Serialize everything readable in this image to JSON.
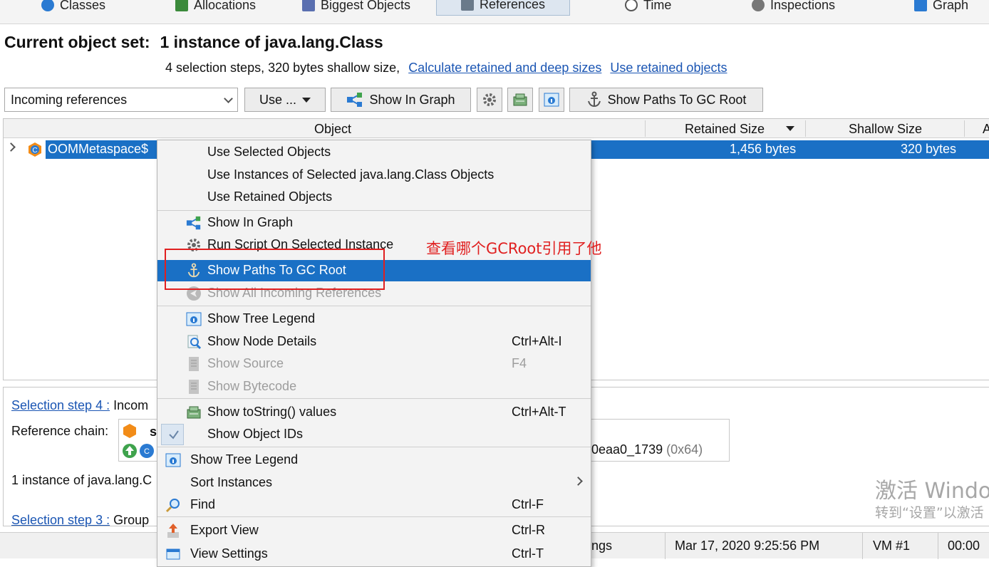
{
  "tabs": [
    {
      "label": "Classes",
      "icon": "classes-icon"
    },
    {
      "label": "Allocations",
      "icon": "allocations-icon"
    },
    {
      "label": "Biggest Objects",
      "icon": "biggest-objects-icon"
    },
    {
      "label": "References",
      "icon": "references-icon",
      "active": true
    },
    {
      "label": "Time",
      "icon": "clock-icon"
    },
    {
      "label": "Inspections",
      "icon": "gear-icon"
    },
    {
      "label": "Graph",
      "icon": "graph-icon"
    }
  ],
  "header": {
    "title_label": "Current object set:",
    "title_value": "1 instance of java.lang.Class",
    "info": "4 selection steps, 320 bytes shallow size,",
    "link_calc": "Calculate retained and deep sizes",
    "link_retained": "Use retained objects"
  },
  "toolbar": {
    "view_select": "Incoming references",
    "use_button": "Use ...",
    "show_in_graph": "Show In Graph",
    "show_paths": "Show Paths To GC Root"
  },
  "table": {
    "columns": [
      "Object",
      "Retained Size",
      "Shallow Size",
      "A"
    ],
    "rows": [
      {
        "object": "OOMMetaspace$",
        "retained": "1,456 bytes",
        "shallow": "320 bytes"
      }
    ]
  },
  "bottom": {
    "step4_link": "Selection step 4 :",
    "step4_text": "Incom",
    "chain_label": "Reference chain:",
    "chain_snippet": "s",
    "chain_id": "0eaa0_1739",
    "chain_hex": "(0x64)",
    "instance_text": "1 instance of java.lang.C",
    "step3_link": "Selection step 3 :",
    "step3_text": "Group"
  },
  "status": {
    "partial": "ngs",
    "datetime": "Mar 17, 2020 9:25:56 PM",
    "vm": "VM #1",
    "time": "00:00"
  },
  "watermark": {
    "line1": "激活 Windo",
    "line2": "转到“设置”以激活"
  },
  "menu": {
    "items": [
      {
        "label": "Use Selected Objects"
      },
      {
        "label": "Use Instances of Selected java.lang.Class Objects"
      },
      {
        "label": "Use Retained Objects"
      },
      {
        "label": "Show In Graph"
      },
      {
        "label": "Run Script On Selected Instance"
      },
      {
        "label": "Show Paths To GC Root"
      },
      {
        "label": "Show All Incoming References"
      },
      {
        "label": "Show Tree Legend"
      },
      {
        "label": "Show Node Details",
        "shortcut": "Ctrl+Alt-I"
      },
      {
        "label": "Show Source",
        "shortcut": "F4"
      },
      {
        "label": "Show Bytecode"
      },
      {
        "label": "Show toString() values",
        "shortcut": "Ctrl+Alt-T"
      },
      {
        "label": "Show Object IDs"
      },
      {
        "label": "Show Tree Legend"
      },
      {
        "label": "Sort Instances"
      },
      {
        "label": "Find",
        "shortcut": "Ctrl-F"
      },
      {
        "label": "Export View",
        "shortcut": "Ctrl-R"
      },
      {
        "label": "View Settings",
        "shortcut": "Ctrl-T"
      }
    ]
  },
  "annotation": {
    "text": "查看哪个GCRoot引用了他",
    "color": "#e02020"
  },
  "colors": {
    "selection": "#1a70c5",
    "link": "#1a55b3"
  }
}
